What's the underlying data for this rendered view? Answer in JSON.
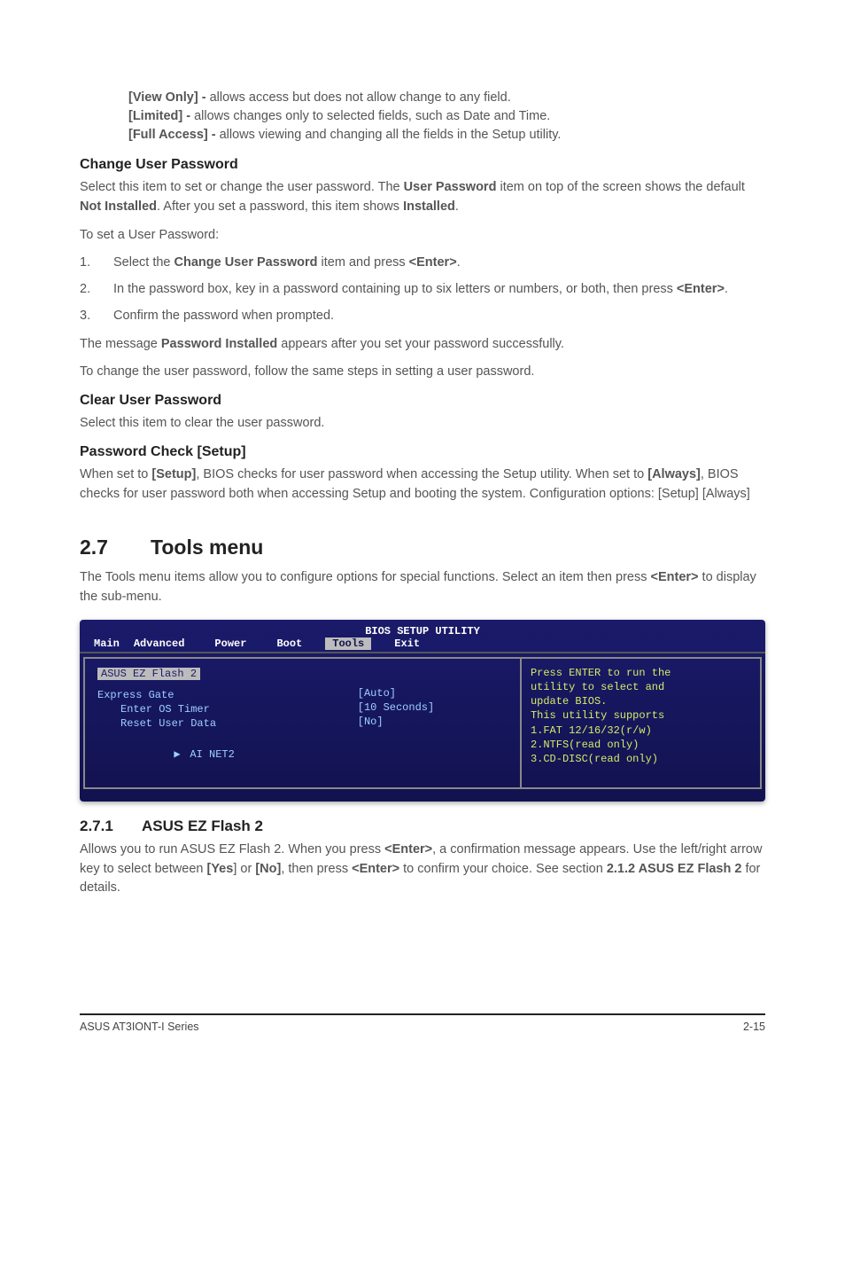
{
  "top_options": {
    "view_only_label": "[View Only] - ",
    "view_only_text": "allows access but does not allow change to any field.",
    "limited_label": "[Limited] - ",
    "limited_text": "allows changes only to selected fields, such as Date and Time.",
    "full_access_label": "[Full Access] - ",
    "full_access_text": "allows viewing and changing all the fields in the Setup utility."
  },
  "cup": {
    "heading": "Change User Password",
    "p1a": "Select this item to set or change the user password. The ",
    "p1b": "User Password",
    "p1c": " item on top of the screen shows the default ",
    "p1d": "Not Installed",
    "p1e": ". After you set a password, this item shows ",
    "p1f": "Installed",
    "p1g": ".",
    "p2": "To set a User Password:",
    "li1a": "Select the ",
    "li1b": "Change User Password",
    "li1c": " item and press ",
    "li1d": "<Enter>",
    "li1e": ".",
    "li2a": "In the password box, key in a password containing up to six letters or numbers, or both, then press ",
    "li2b": "<Enter>",
    "li2c": ".",
    "li3": "Confirm the password when prompted.",
    "p3a": "The message ",
    "p3b": "Password Installed",
    "p3c": " appears after you set your password successfully.",
    "p4": "To change the user password, follow the same steps in setting a user password."
  },
  "clup": {
    "heading": "Clear User Password",
    "p": "Select this item to clear the user password."
  },
  "pwc": {
    "heading": "Password Check [Setup]",
    "p1a": "When set to ",
    "p1b": "[Setup]",
    "p1c": ", BIOS checks for user password when accessing the Setup utility. When set to ",
    "p1d": "[Always]",
    "p1e": ", BIOS checks for user password both when accessing Setup and booting the system. Configuration options: [Setup] [Always]"
  },
  "tools": {
    "secnum": "2.7",
    "heading": "Tools menu",
    "p1a": "The Tools menu items allow you to configure options for special functions. Select an item then press ",
    "p1b": "<Enter>",
    "p1c": " to display the sub-menu."
  },
  "bios": {
    "title": "BIOS SETUP UTILITY",
    "tabs": {
      "main": "Main",
      "advanced": "Advanced",
      "power": "Power",
      "boot": "Boot",
      "tools": "Tools",
      "exit": "Exit"
    },
    "left": {
      "row0": "ASUS EZ Flash 2",
      "row1": "Express Gate",
      "row1v": "[Auto]",
      "row2": "Enter OS Timer",
      "row2v": "[10 Seconds]",
      "row3": "Reset User Data",
      "row3v": "[No]",
      "row4_arrow": "▶",
      "row4": "AI NET2"
    },
    "right": {
      "l1": "Press ENTER to run the",
      "l2": "utility to select and",
      "l3": "update BIOS.",
      "l4": "This utility supports",
      "l5": "1.FAT 12/16/32(r/w)",
      "l6": "2.NTFS(read only)",
      "l7": "3.CD-DISC(read only)"
    }
  },
  "ez": {
    "secnum": "2.7.1",
    "heading": "ASUS EZ Flash 2",
    "p1a": "Allows you to run ASUS EZ Flash 2. When you press ",
    "p1b": "<Enter>",
    "p1c": ", a confirmation message appears. Use the left/right arrow key to select between ",
    "p1d": "[Yes",
    "p1e": "] or ",
    "p1f": "[No]",
    "p1g": ", then press ",
    "p1h": "<Enter>",
    "p1i": " to confirm your choice. See section ",
    "p1j": "2.1.2 ASUS EZ Flash 2",
    "p1k": " for details."
  },
  "footer": {
    "left": "ASUS AT3IONT-I Series",
    "right": "2-15"
  }
}
